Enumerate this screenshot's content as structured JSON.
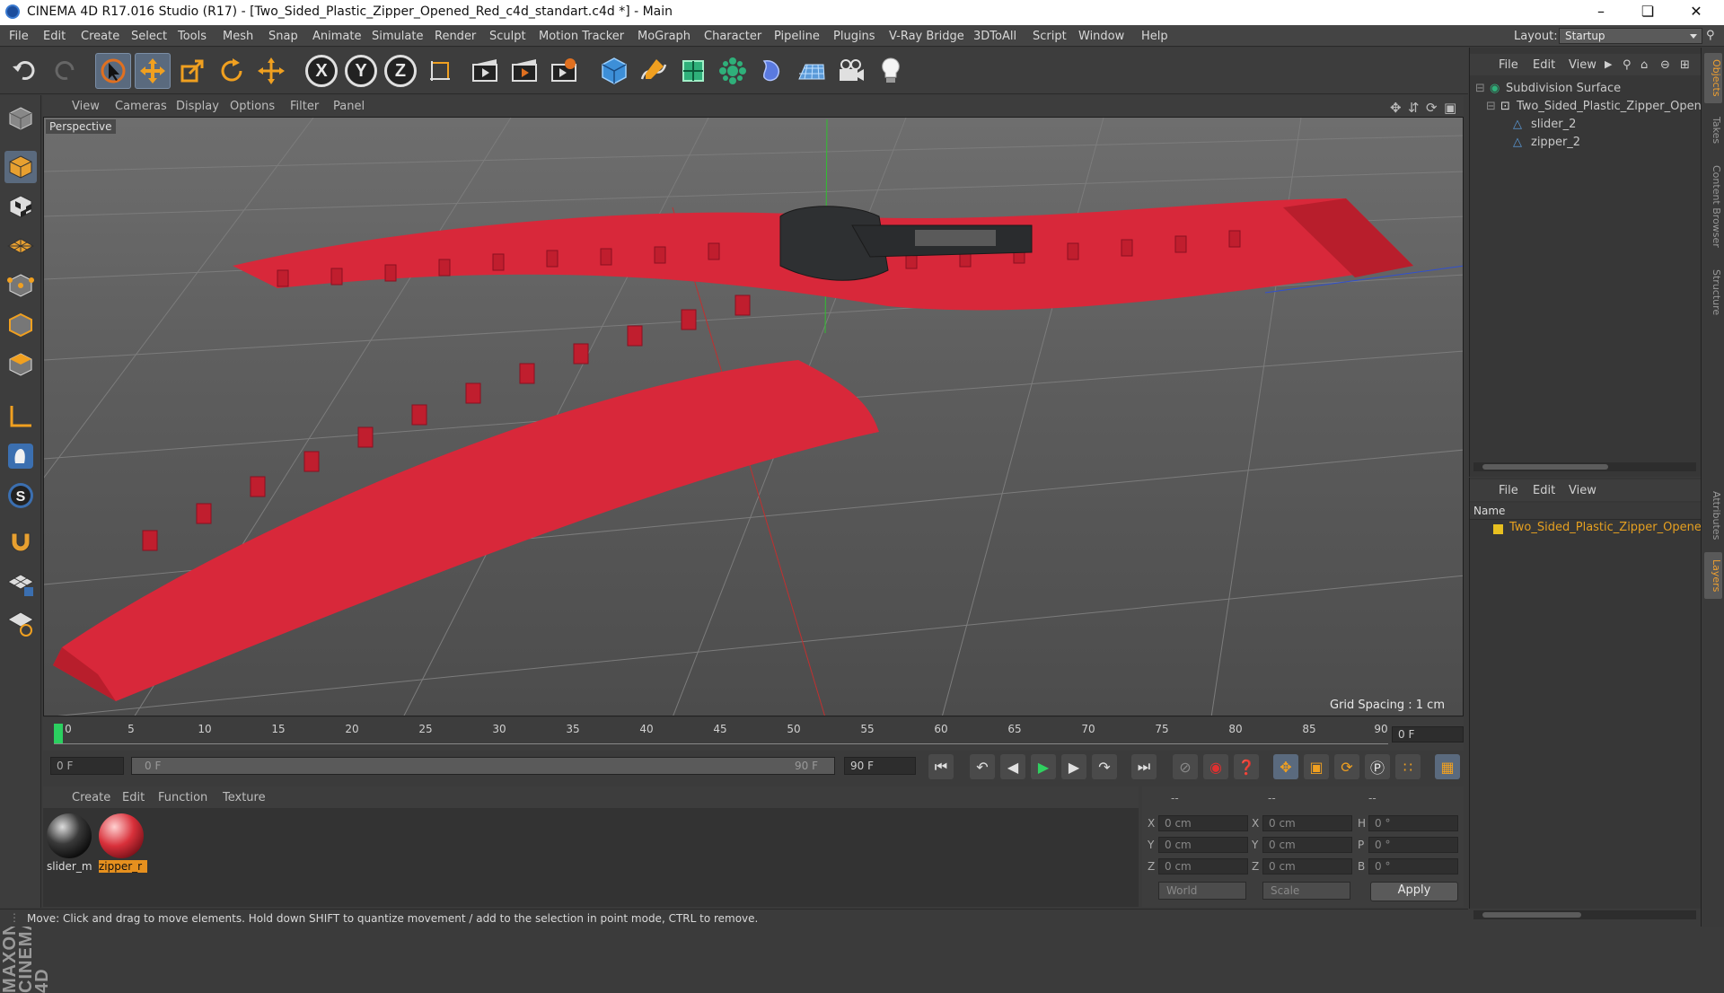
{
  "titlebar": {
    "title": "CINEMA 4D R17.016 Studio (R17) - [Two_Sided_Plastic_Zipper_Opened_Red_c4d_standart.c4d *] - Main"
  },
  "menubar": {
    "items": [
      "File",
      "Edit",
      "Create",
      "Select",
      "Tools",
      "Mesh",
      "Snap",
      "Animate",
      "Simulate",
      "Render",
      "Sculpt",
      "Motion Tracker",
      "MoGraph",
      "Character",
      "Pipeline",
      "Plugins",
      "V-Ray Bridge",
      "3DToAll",
      "Script",
      "Window",
      "Help"
    ],
    "layout_label": "Layout:",
    "layout_value": "Startup"
  },
  "toolbar": {
    "axes": [
      "X",
      "Y",
      "Z"
    ]
  },
  "viewport": {
    "menu": [
      "View",
      "Cameras",
      "Display",
      "Options",
      "Filter",
      "Panel"
    ],
    "label": "Perspective",
    "grid_spacing": "Grid Spacing : 1 cm"
  },
  "timeline": {
    "ticks": [
      "0",
      "5",
      "10",
      "15",
      "20",
      "25",
      "30",
      "35",
      "40",
      "45",
      "50",
      "55",
      "60",
      "65",
      "70",
      "75",
      "80",
      "85",
      "90"
    ],
    "current_frame": "0 F"
  },
  "transport": {
    "start_field": "0 F",
    "range_start": "0 F",
    "range_end": "90 F",
    "end_field": "90 F"
  },
  "material_manager": {
    "menu": [
      "Create",
      "Edit",
      "Function",
      "Texture"
    ],
    "materials": [
      {
        "name": "slider_m",
        "color": "#2a2a2a"
      },
      {
        "name": "zipper_r",
        "color": "#d8303a"
      }
    ]
  },
  "coordinates": {
    "header": [
      "--",
      "--",
      "--"
    ],
    "rows": [
      {
        "l1": "X",
        "v1": "0 cm",
        "l2": "X",
        "v2": "0 cm",
        "l3": "H",
        "v3": "0 °"
      },
      {
        "l1": "Y",
        "v1": "0 cm",
        "l2": "Y",
        "v2": "0 cm",
        "l3": "P",
        "v3": "0 °"
      },
      {
        "l1": "Z",
        "v1": "0 cm",
        "l2": "Z",
        "v2": "0 cm",
        "l3": "B",
        "v3": "0 °"
      }
    ],
    "mode_world": "World",
    "mode_scale": "Scale",
    "apply": "Apply"
  },
  "objects_panel": {
    "menu": [
      "File",
      "Edit",
      "View"
    ],
    "items": [
      "Subdivision Surface",
      "Two_Sided_Plastic_Zipper_Opened",
      "slider_2",
      "zipper_2"
    ]
  },
  "layers_panel": {
    "menu": [
      "File",
      "Edit",
      "View"
    ],
    "column": "Name",
    "layer": "Two_Sided_Plastic_Zipper_Opened",
    "layer_color": "#e8c020"
  },
  "side_tabs": [
    "Objects",
    "Takes",
    "Content Browser",
    "Structure",
    "Attributes",
    "Layers"
  ],
  "status": "Move: Click and drag to move elements. Hold down SHIFT to quantize movement / add to the selection in point mode, CTRL to remove.",
  "branding": "MAXON CINEMA 4D"
}
